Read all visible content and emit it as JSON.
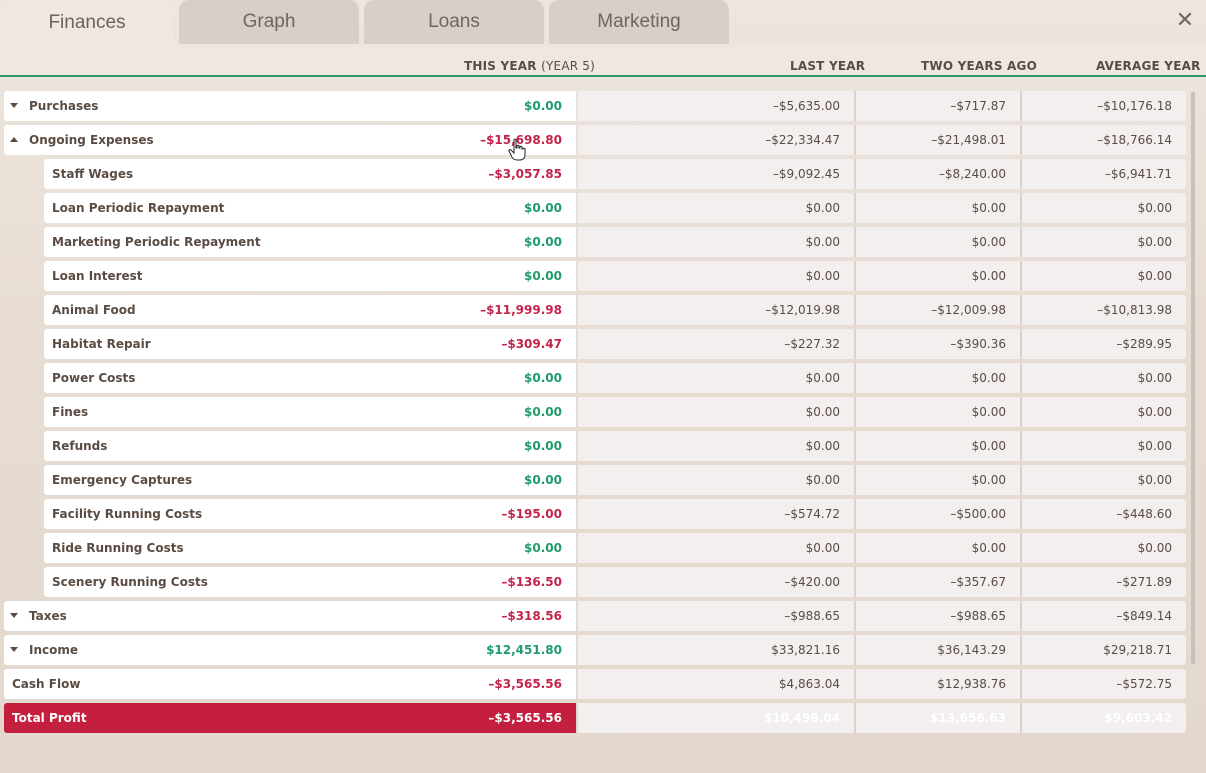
{
  "tabs": [
    "Finances",
    "Graph",
    "Loans",
    "Marketing"
  ],
  "active_tab": "Finances",
  "close_icon": "close-icon",
  "columns": {
    "this_year": "THIS YEAR",
    "this_year_sub": "(YEAR 5)",
    "last_year": "LAST YEAR",
    "two_years_ago": "TWO YEARS AGO",
    "average_year": "AVERAGE YEAR"
  },
  "rows": [
    {
      "label": "Purchases",
      "expander": "collapsed",
      "this_year": "$0.00",
      "last_year": "–$5,635.00",
      "two_years_ago": "–$717.87",
      "average_year": "–$10,176.18"
    },
    {
      "label": "Ongoing Expenses",
      "expander": "expanded",
      "this_year": "–$15,698.80",
      "last_year": "–$22,334.47",
      "two_years_ago": "–$21,498.01",
      "average_year": "–$18,766.14"
    },
    {
      "label": "Staff Wages",
      "this_year": "–$3,057.85",
      "last_year": "–$9,092.45",
      "two_years_ago": "–$8,240.00",
      "average_year": "–$6,941.71"
    },
    {
      "label": "Loan Periodic Repayment",
      "this_year": "$0.00",
      "last_year": "$0.00",
      "two_years_ago": "$0.00",
      "average_year": "$0.00"
    },
    {
      "label": "Marketing Periodic Repayment",
      "this_year": "$0.00",
      "last_year": "$0.00",
      "two_years_ago": "$0.00",
      "average_year": "$0.00"
    },
    {
      "label": "Loan Interest",
      "this_year": "$0.00",
      "last_year": "$0.00",
      "two_years_ago": "$0.00",
      "average_year": "$0.00"
    },
    {
      "label": "Animal Food",
      "this_year": "–$11,999.98",
      "last_year": "–$12,019.98",
      "two_years_ago": "–$12,009.98",
      "average_year": "–$10,813.98"
    },
    {
      "label": "Habitat Repair",
      "this_year": "–$309.47",
      "last_year": "–$227.32",
      "two_years_ago": "–$390.36",
      "average_year": "–$289.95"
    },
    {
      "label": "Power Costs",
      "this_year": "$0.00",
      "last_year": "$0.00",
      "two_years_ago": "$0.00",
      "average_year": "$0.00"
    },
    {
      "label": "Fines",
      "this_year": "$0.00",
      "last_year": "$0.00",
      "two_years_ago": "$0.00",
      "average_year": "$0.00"
    },
    {
      "label": "Refunds",
      "this_year": "$0.00",
      "last_year": "$0.00",
      "two_years_ago": "$0.00",
      "average_year": "$0.00"
    },
    {
      "label": "Emergency Captures",
      "this_year": "$0.00",
      "last_year": "$0.00",
      "two_years_ago": "$0.00",
      "average_year": "$0.00"
    },
    {
      "label": "Facility Running Costs",
      "this_year": "–$195.00",
      "last_year": "–$574.72",
      "two_years_ago": "–$500.00",
      "average_year": "–$448.60"
    },
    {
      "label": "Ride Running Costs",
      "this_year": "$0.00",
      "last_year": "$0.00",
      "two_years_ago": "$0.00",
      "average_year": "$0.00"
    },
    {
      "label": "Scenery Running Costs",
      "this_year": "–$136.50",
      "last_year": "–$420.00",
      "two_years_ago": "–$357.67",
      "average_year": "–$271.89"
    },
    {
      "label": "Taxes",
      "expander": "collapsed",
      "this_year": "–$318.56",
      "last_year": "–$988.65",
      "two_years_ago": "–$988.65",
      "average_year": "–$849.14"
    },
    {
      "label": "Income",
      "expander": "collapsed",
      "this_year": "$12,451.80",
      "last_year": "$33,821.16",
      "two_years_ago": "$36,143.29",
      "average_year": "$29,218.71"
    },
    {
      "label": "Cash Flow",
      "this_year": "–$3,565.56",
      "last_year": "$4,863.04",
      "two_years_ago": "$12,938.76",
      "average_year": "–$572.75"
    },
    {
      "label": "Total Profit",
      "this_year": "–$3,565.56",
      "last_year": "$10,498.04",
      "two_years_ago": "$13,656.63",
      "average_year": "$9,603.42"
    }
  ],
  "colors": {
    "positive": "#1f9b6b",
    "negative": "#c4244a",
    "total_bg": "#c41f3e",
    "accent_line": "#2b9a6d"
  }
}
